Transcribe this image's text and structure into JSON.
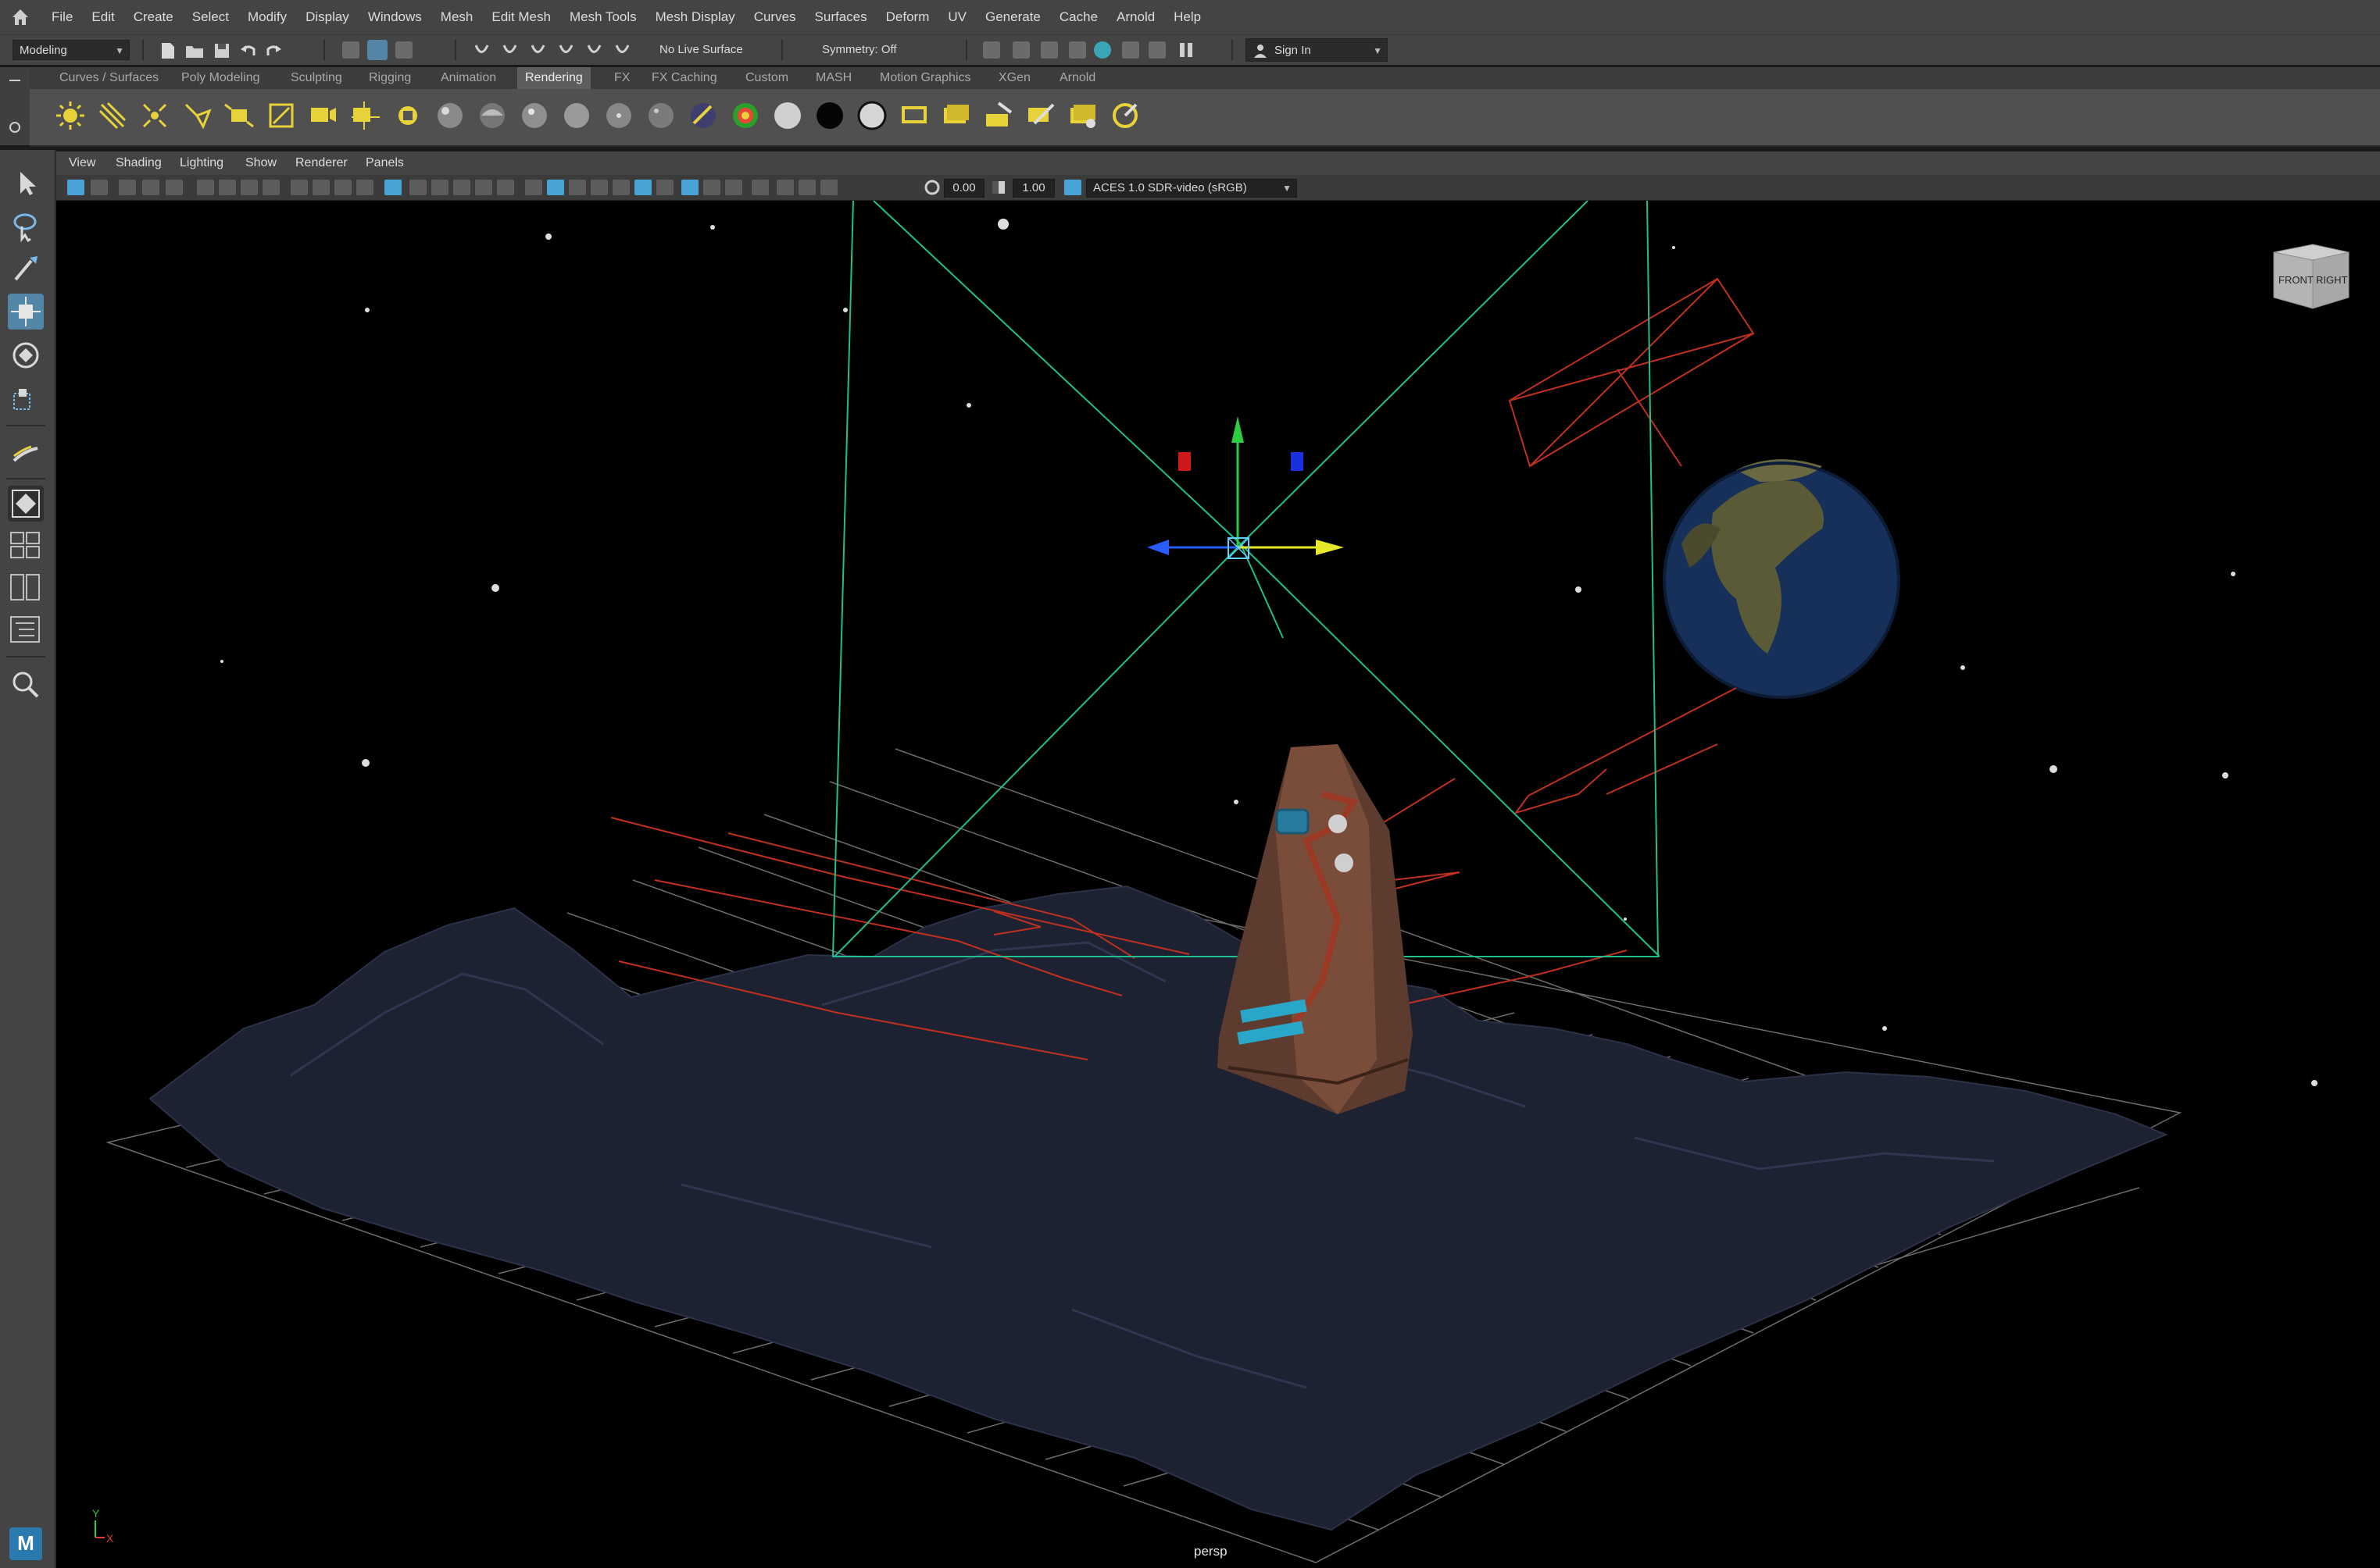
{
  "menubar": {
    "items": [
      "File",
      "Edit",
      "Create",
      "Select",
      "Modify",
      "Display",
      "Windows",
      "Mesh",
      "Edit Mesh",
      "Mesh Tools",
      "Mesh Display",
      "Curves",
      "Surfaces",
      "Deform",
      "UV",
      "Generate",
      "Cache",
      "Arnold",
      "Help"
    ]
  },
  "statusline": {
    "mode": "Modeling",
    "live_surface": "No Live Surface",
    "symmetry": "Symmetry: Off",
    "sign_in": "Sign In"
  },
  "shelf": {
    "tabs": [
      "Curves / Surfaces",
      "Poly Modeling",
      "Sculpting",
      "Rigging",
      "Animation",
      "Rendering",
      "FX",
      "FX Caching",
      "Custom",
      "MASH",
      "Motion Graphics",
      "XGen",
      "Arnold"
    ],
    "active_tab": "Rendering"
  },
  "panel": {
    "menus": [
      "View",
      "Shading",
      "Lighting",
      "Show",
      "Renderer",
      "Panels"
    ],
    "exposure": "0.00",
    "gamma": "1.00",
    "color_space": "ACES 1.0 SDR-video (sRGB)"
  },
  "viewport": {
    "camera": "persp",
    "viewcube_front": "FRONT",
    "viewcube_right": "RIGHT",
    "axis_y": "Y",
    "axis_x": "X"
  },
  "colors": {
    "accent": "#5285a6",
    "light_frustum": "#1fbf8f",
    "light_lines": "#c0301e"
  },
  "app_logo": "M"
}
